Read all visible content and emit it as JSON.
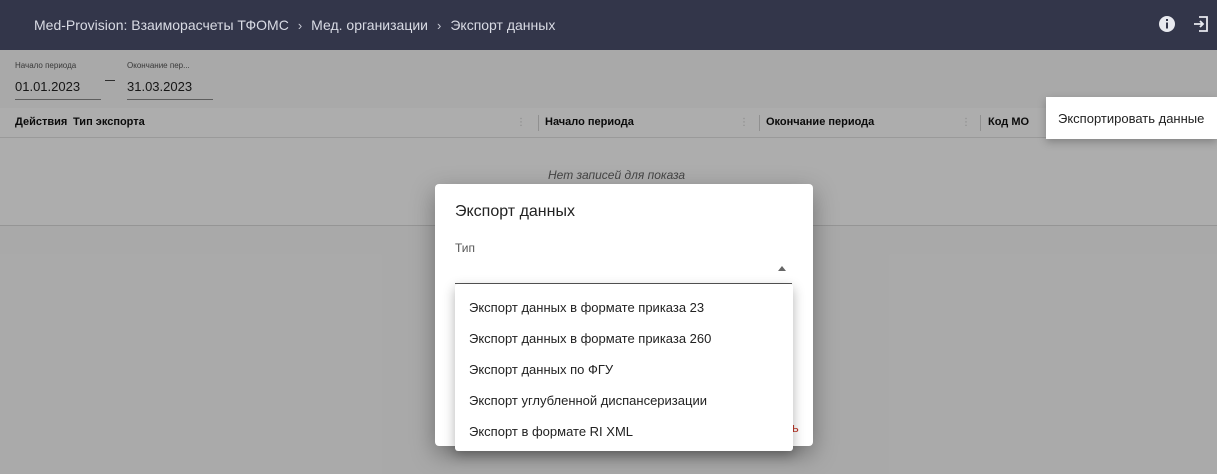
{
  "header": {
    "breadcrumbs": [
      "Med-Provision: Взаиморасчеты ТФОМС",
      "Мед. организации",
      "Экспорт данных"
    ],
    "separator": "›",
    "icons": [
      "info-icon",
      "logout-icon"
    ]
  },
  "filters": {
    "start": {
      "label": "Начало периода",
      "value": "01.01.2023"
    },
    "end": {
      "label": "Окончание пер...",
      "value": "31.03.2023"
    }
  },
  "toolbar": {
    "icons": [
      "menu-icon",
      "columns-icon"
    ]
  },
  "export_menu": {
    "item": "Экспортировать данные"
  },
  "table": {
    "columns": [
      "Действия",
      "Тип экспорта",
      "Начало периода",
      "Окончание периода",
      "Код МО"
    ],
    "empty_text": "Нет записей для показа"
  },
  "dialog": {
    "title": "Экспорт данных",
    "type_label": "Тип",
    "type_value": "",
    "action_partial": "ь",
    "options": [
      "Экспорт данных в формате приказа 23",
      "Экспорт данных в формате приказа 260",
      "Экспорт данных по ФГУ",
      "Экспорт углубленной диспансеризации",
      "Экспорт в формате RI XML"
    ]
  },
  "colors": {
    "topbar": "#33364a",
    "accent_red": "#c0392b",
    "overlay": "rgba(0,0,0,0.32)"
  }
}
